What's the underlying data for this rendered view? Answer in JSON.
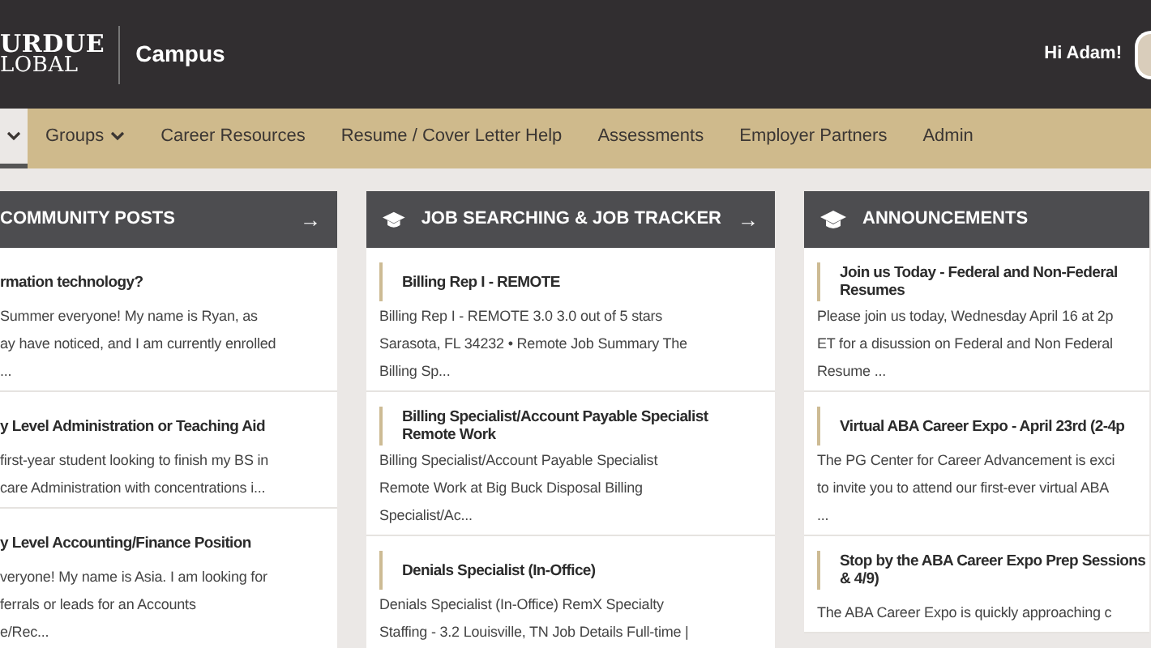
{
  "header": {
    "logo_lines": [
      "URDUE",
      "LOBAL"
    ],
    "site": "Campus",
    "greeting": "Hi Adam!"
  },
  "nav": [
    {
      "caret": true,
      "selected": true
    },
    {
      "label": "Groups",
      "caret": true,
      "selected": false
    },
    {
      "label": "Career Resources",
      "caret": false,
      "selected": false
    },
    {
      "label": "Resume / Cover Letter Help",
      "caret": false,
      "selected": false
    },
    {
      "label": "Assessments",
      "caret": false,
      "selected": false
    },
    {
      "label": "Employer Partners",
      "caret": false,
      "selected": false
    },
    {
      "label": "Admin",
      "caret": false,
      "selected": false
    }
  ],
  "panels": [
    {
      "title": "COMMUNITY POSTS",
      "icon": false,
      "arrow": "→",
      "accent": false,
      "items": [
        {
          "title_lines": [
            "rmation technology?"
          ],
          "lines": [
            "Summer everyone! My name is Ryan, as",
            "ay have noticed, and I am currently enrolled",
            "..."
          ]
        },
        {
          "title_lines": [
            "y Level Administration or Teaching Aid"
          ],
          "lines": [
            "first-year student looking to finish my BS in",
            "care Administration with concentrations i..."
          ]
        },
        {
          "title_lines": [
            "y Level Accounting/Finance Position"
          ],
          "lines": [
            "veryone! My name is Asia. I am looking for",
            "ferrals or leads for an Accounts",
            "e/Rec..."
          ]
        }
      ]
    },
    {
      "title": "JOB SEARCHING & JOB TRACKER",
      "icon": true,
      "arrow": "→",
      "accent": true,
      "items": [
        {
          "title_lines": [
            "Billing Rep I - REMOTE"
          ],
          "lines": [
            "Billing Rep I - REMOTE 3.0 3.0 out of 5 stars",
            "Sarasota, FL 34232 • Remote Job Summary The",
            "Billing Sp..."
          ]
        },
        {
          "title_lines": [
            "Billing Specialist/Account Payable Specialist",
            "Remote Work"
          ],
          "lines": [
            "Billing Specialist/Account Payable Specialist",
            "Remote Work at Big Buck Disposal Billing",
            "Specialist/Ac..."
          ]
        },
        {
          "title_lines": [
            "Denials Specialist (In-Office)"
          ],
          "lines": [
            "Denials Specialist (In-Office) RemX Specialty",
            "Staffing - 3.2 Louisville, TN Job Details Full-time |"
          ]
        }
      ]
    },
    {
      "title": "ANNOUNCEMENTS",
      "icon": true,
      "accent": true,
      "items": [
        {
          "title_lines": [
            "Join us Today - Federal and Non-Federal",
            "Resumes"
          ],
          "lines": [
            "Please join us today, Wednesday April 16 at 2p",
            "ET for a disussion on Federal and Non Federal",
            "Resume ..."
          ]
        },
        {
          "title_lines": [
            "Virtual ABA Career Expo - April 23rd (2-4p"
          ],
          "lines": [
            "The PG Center for Career Advancement is exci",
            "to invite you to attend our first-ever virtual ABA",
            "..."
          ]
        },
        {
          "title_lines": [
            "Stop by the ABA Career Expo Prep Sessions",
            "& 4/9)"
          ],
          "lines": [
            "The ABA Career Expo is quickly approaching c"
          ]
        }
      ]
    }
  ]
}
